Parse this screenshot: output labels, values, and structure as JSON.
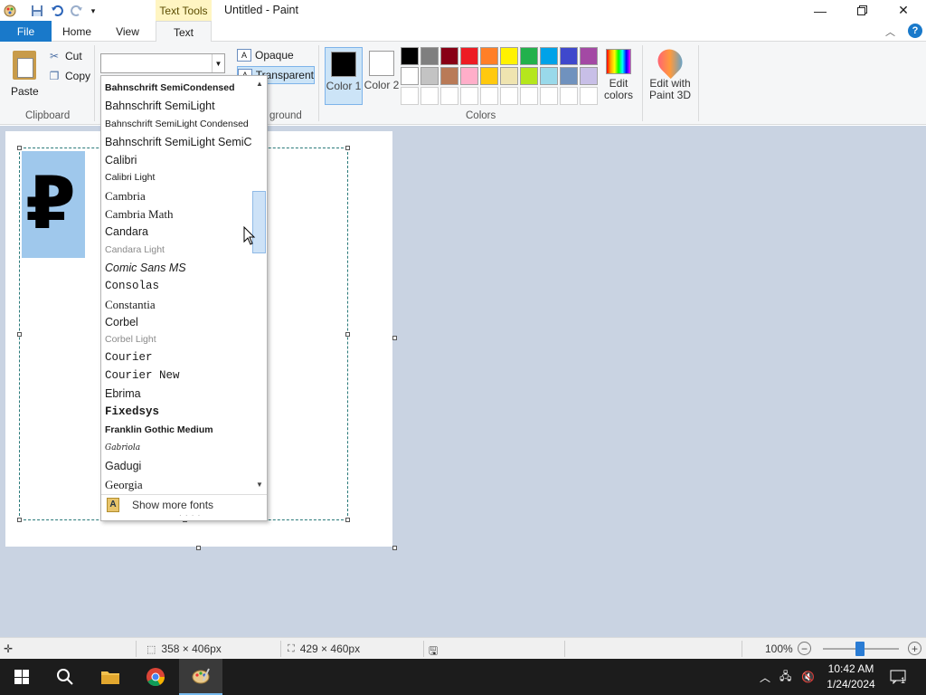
{
  "window": {
    "title": "Untitled - Paint",
    "context_tab_group": "Text Tools"
  },
  "tabs": {
    "file": "File",
    "home": "Home",
    "view": "View",
    "text": "Text"
  },
  "clipboard": {
    "paste": "Paste",
    "cut": "Cut",
    "copy": "Copy",
    "group_label": "Clipboard"
  },
  "background": {
    "opaque": "Opaque",
    "transparent": "Transparent",
    "group_label": "Background",
    "group_label_visible": "ground"
  },
  "colors": {
    "color1_label": "Color 1",
    "color2_label": "Color 2",
    "color1_value": "#000000",
    "color2_value": "#ffffff",
    "group_label": "Colors",
    "edit_colors": "Edit colors",
    "edit_paint3d": "Edit with Paint 3D",
    "palette": [
      "#000000",
      "#7f7f7f",
      "#880015",
      "#ed1c24",
      "#ff7f27",
      "#fff200",
      "#22b14c",
      "#00a2e8",
      "#3f48cc",
      "#a349a4",
      "#ffffff",
      "#c3c3c3",
      "#b97a57",
      "#ffaec9",
      "#ffc90e",
      "#efe4b0",
      "#b5e61d",
      "#99d9ea",
      "#7092be",
      "#c8bfe7",
      "#ffffff",
      "#ffffff",
      "#ffffff",
      "#ffffff",
      "#ffffff",
      "#ffffff",
      "#ffffff",
      "#ffffff",
      "#ffffff",
      "#ffffff"
    ]
  },
  "font_dropdown": {
    "current_value": "",
    "show_more": "Show more fonts",
    "items": [
      {
        "label": "Bahnschrift SemiCondensed",
        "style": "bold small"
      },
      {
        "label": "Bahnschrift SemiLight",
        "style": ""
      },
      {
        "label": "Bahnschrift SemiLight Condensed",
        "style": "small"
      },
      {
        "label": "Bahnschrift SemiLight SemiConde",
        "style": ""
      },
      {
        "label": "Calibri",
        "style": ""
      },
      {
        "label": "Calibri Light",
        "style": "small"
      },
      {
        "label": "Cambria",
        "style": "serif"
      },
      {
        "label": "Cambria Math",
        "style": "serif"
      },
      {
        "label": "Candara",
        "style": ""
      },
      {
        "label": "Candara Light",
        "style": "light small"
      },
      {
        "label": "Comic Sans MS",
        "style": "italic"
      },
      {
        "label": "Consolas",
        "style": "mono"
      },
      {
        "label": "Constantia",
        "style": "serif"
      },
      {
        "label": "Corbel",
        "style": ""
      },
      {
        "label": "Corbel Light",
        "style": "light small"
      },
      {
        "label": "Courier",
        "style": "mono"
      },
      {
        "label": "Courier New",
        "style": "mono"
      },
      {
        "label": "Ebrima",
        "style": ""
      },
      {
        "label": "Fixedsys",
        "style": "mono bold"
      },
      {
        "label": "Franklin Gothic Medium",
        "style": "bold small"
      },
      {
        "label": "Gabriola",
        "style": "script"
      },
      {
        "label": "Gadugi",
        "style": ""
      },
      {
        "label": "Georgia",
        "style": "serif"
      }
    ]
  },
  "canvas": {
    "text_content": "₽"
  },
  "statusbar": {
    "selection_size": "358 × 406px",
    "canvas_size": "429 × 460px",
    "zoom": "100%"
  },
  "taskbar": {
    "time": "10:42 AM",
    "date": "1/24/2024",
    "notification_count": "1"
  }
}
